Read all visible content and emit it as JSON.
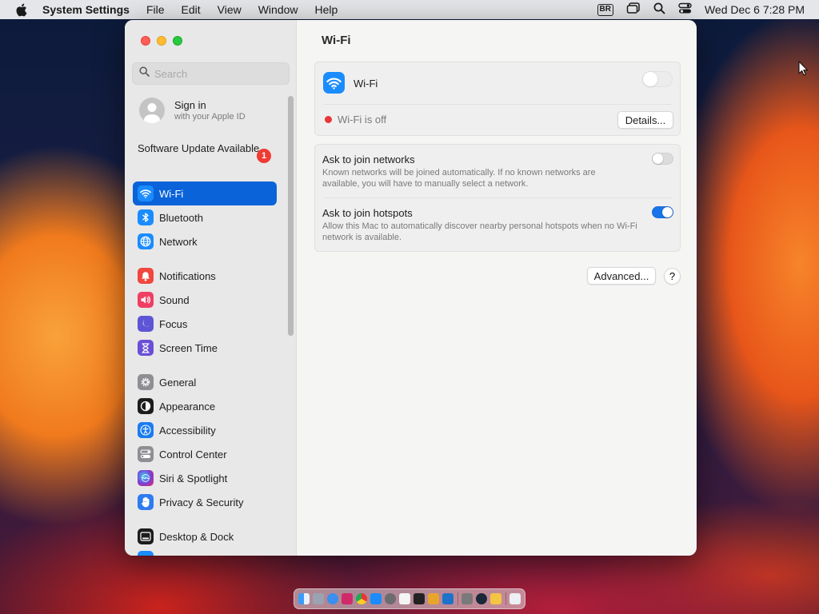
{
  "menubar": {
    "app_name": "System Settings",
    "items": [
      "File",
      "Edit",
      "View",
      "Window",
      "Help"
    ],
    "input_source": "BR",
    "clock": "Wed Dec 6  7:28 PM"
  },
  "sidebar": {
    "search_placeholder": "Search",
    "account": {
      "title": "Sign in",
      "subtitle": "with your Apple ID"
    },
    "software_update": {
      "label": "Software Update Available",
      "badge": "1"
    },
    "items": [
      {
        "label": "Wi-Fi",
        "icon": "wifi-icon",
        "color": "#1a8cff"
      },
      {
        "label": "Bluetooth",
        "icon": "bluetooth-icon",
        "color": "#1a8cff"
      },
      {
        "label": "Network",
        "icon": "globe-icon",
        "color": "#1a8cff"
      },
      {
        "label": "Notifications",
        "icon": "bell-icon",
        "color": "#f0473f"
      },
      {
        "label": "Sound",
        "icon": "speaker-icon",
        "color": "#ef3f63"
      },
      {
        "label": "Focus",
        "icon": "moon-icon",
        "color": "#5e55d6"
      },
      {
        "label": "Screen Time",
        "icon": "hourglass-icon",
        "color": "#6a4fd6"
      },
      {
        "label": "General",
        "icon": "gear-icon",
        "color": "#8e8e93"
      },
      {
        "label": "Appearance",
        "icon": "appearance-icon",
        "color": "#1c1c1e"
      },
      {
        "label": "Accessibility",
        "icon": "accessibility-icon",
        "color": "#1a7cf0"
      },
      {
        "label": "Control Center",
        "icon": "control-center-icon",
        "color": "#8e8e93"
      },
      {
        "label": "Siri & Spotlight",
        "icon": "siri-icon",
        "color": "#7a3dd6"
      },
      {
        "label": "Privacy & Security",
        "icon": "hand-icon",
        "color": "#2f7bf0"
      },
      {
        "label": "Desktop & Dock",
        "icon": "desktop-icon",
        "color": "#1c1c1e"
      }
    ],
    "selected_color": "#0a63d9"
  },
  "main": {
    "title": "Wi-Fi",
    "wifi": {
      "label": "Wi-Fi",
      "status": "Wi-Fi is off",
      "details_button": "Details...",
      "enabled": false
    },
    "ask_networks": {
      "title": "Ask to join networks",
      "description": "Known networks will be joined automatically. If no known networks are available, you will have to manually select a network.",
      "enabled": false
    },
    "ask_hotspots": {
      "title": "Ask to join hotspots",
      "description": "Allow this Mac to automatically discover nearby personal hotspots when no Wi-Fi network is available.",
      "enabled": true
    },
    "advanced_button": "Advanced...",
    "help_button": "?"
  }
}
